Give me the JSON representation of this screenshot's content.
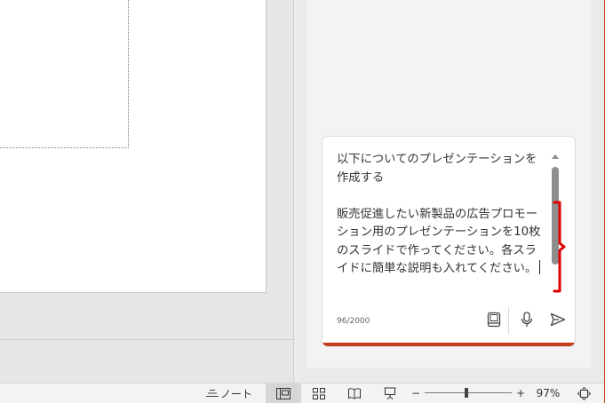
{
  "copilot": {
    "prompt_text": "以下についてのプレゼンテーションを作成する\n\n販売促進したい新製品の広告プロモーション用のプレゼンテーションを10枚のスライドで作ってください。各スライドに簡単な説明も入れてください。",
    "char_counter": "96/2000",
    "accent_color": "#c43e1c",
    "annotation_color": "#e00000"
  },
  "statusbar": {
    "notes_label": "ノート",
    "zoom_minus": "−",
    "zoom_plus": "+",
    "zoom_percent": "97%",
    "zoom_level": 0.45
  }
}
